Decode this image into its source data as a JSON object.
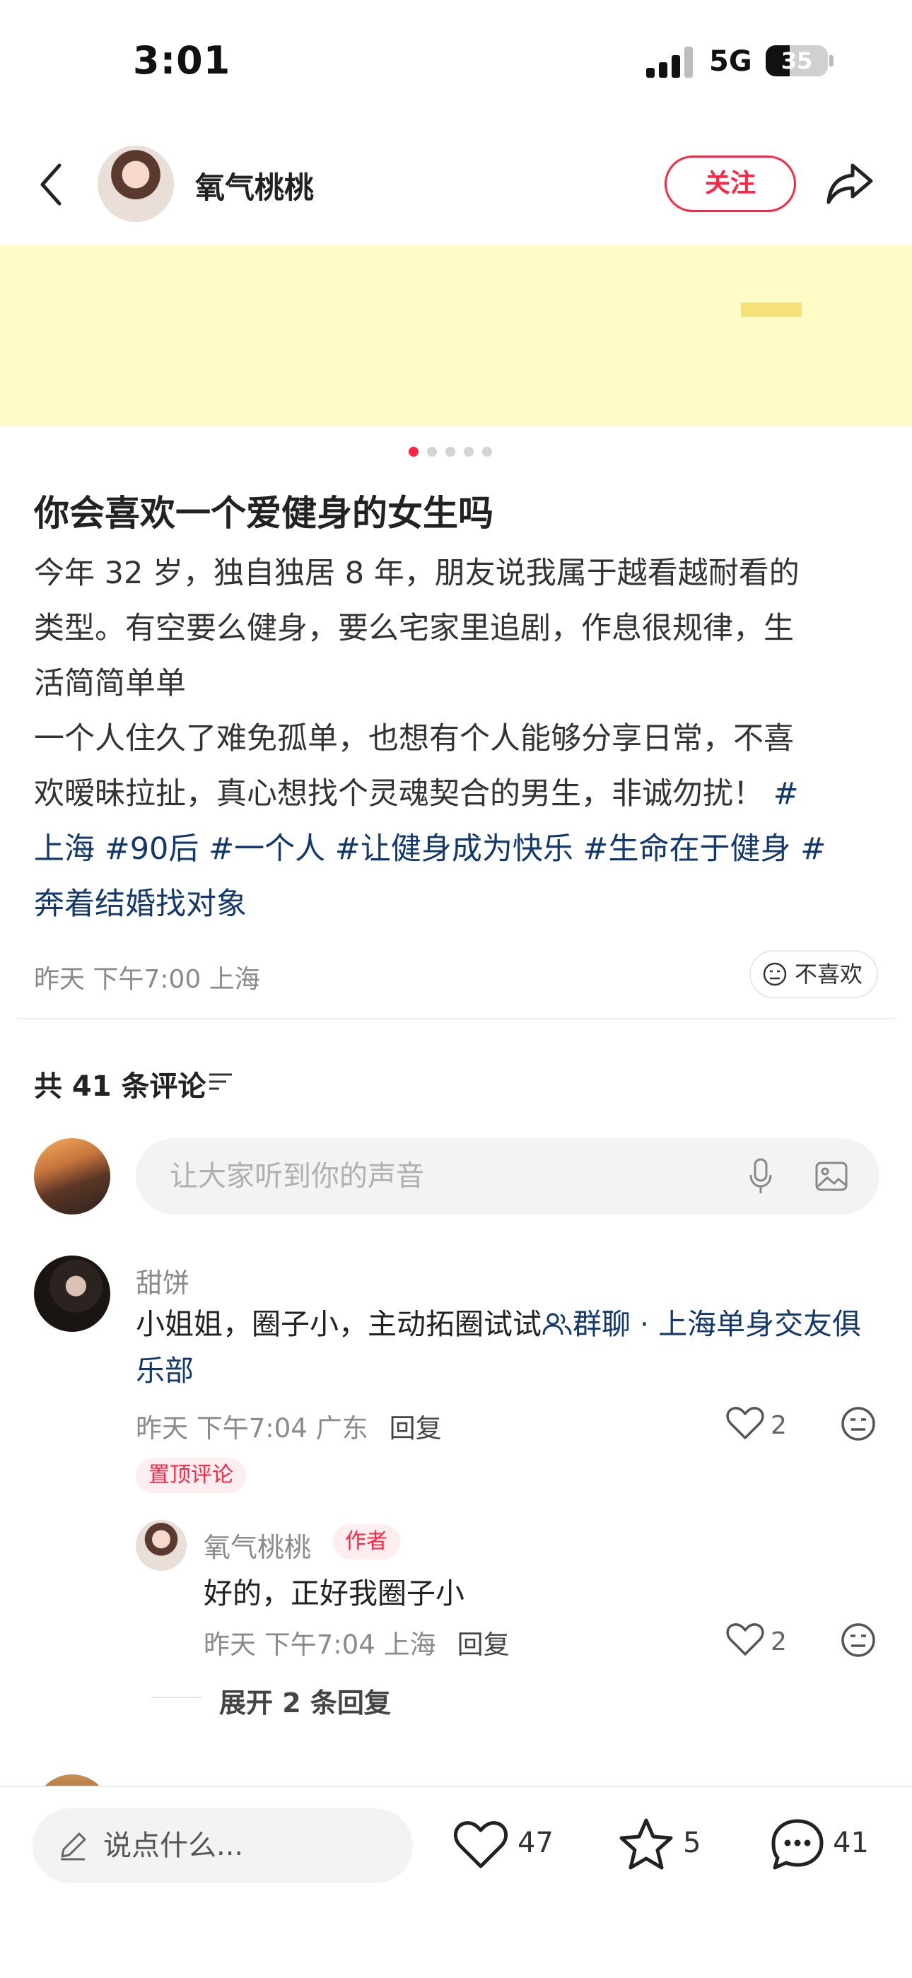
{
  "status_bar": {
    "time": "3:01",
    "network": "5G",
    "battery": "35"
  },
  "header": {
    "author": "氧气桃桃",
    "follow_label": "关注"
  },
  "post": {
    "title": "你会喜欢一个爱健身的女生吗",
    "body_lines": [
      "今年 32 岁，独自独居 8 年，朋友说我属于越看越耐看的",
      "类型。有空要么健身，要么宅家里追剧，作息很规律，生",
      "活简简单单",
      "一个人住久了难免孤单，也想有个人能够分享日常，不喜",
      "欢暧昧拉扯，真心想找个灵魂契合的男生，非诚勿扰！"
    ],
    "tags": [
      "#上海",
      "#90后",
      "#一个人",
      "#让健身成为快乐",
      "#生命在于健身",
      "#奔着结婚找对象"
    ],
    "meta": "昨天 下午7:00 上海",
    "dislike_label": "不喜欢"
  },
  "comments": {
    "count_label": "共 41 条评论",
    "input_placeholder": "让大家听到你的声音",
    "items": [
      {
        "user": "甜饼",
        "text": "小姐姐，圈子小，主动拓圈试试",
        "group_link": "群聊 · 上海单身交友俱乐部",
        "meta": "昨天 下午7:04 广东",
        "reply_label": "回复",
        "likes": "2",
        "pinned_label": "置顶评论",
        "replies": [
          {
            "user": "氧气桃桃",
            "badge": "作者",
            "text": "好的，正好我圈子小",
            "meta": "昨天 下午7:04 上海",
            "reply_label": "回复",
            "likes": "2"
          }
        ],
        "expand_label": "展开 2 条回复"
      }
    ]
  },
  "bottom_bar": {
    "input_placeholder": "说点什么...",
    "likes": "47",
    "collects": "5",
    "comments": "41"
  },
  "colors": {
    "accent": "#ff2442",
    "tag": "#13386c",
    "banner": "#fffbc6"
  },
  "icons": [
    "back-icon",
    "share-icon",
    "microphone-icon",
    "image-icon",
    "filter-icon",
    "people-icon",
    "heart-icon",
    "neutral-face-icon",
    "pen-icon",
    "star-icon",
    "chat-icon"
  ]
}
